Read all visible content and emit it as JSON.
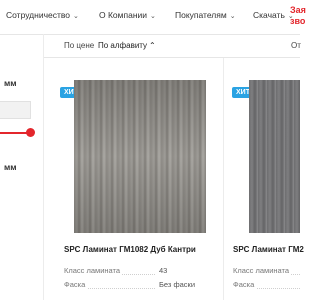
{
  "nav": {
    "items": [
      {
        "label": "Сотрудничество"
      },
      {
        "label": "О Компании"
      },
      {
        "label": "Покупателям"
      },
      {
        "label": "Скачать"
      }
    ],
    "cta_line1": "Зая",
    "cta_line2": "зво"
  },
  "sort": {
    "by_price": "По цене",
    "by_alpha": "По алфавиту",
    "right_cut": "От"
  },
  "sidebar": {
    "filter1_unit": "мм",
    "filter2_unit": "мм"
  },
  "products": [
    {
      "badge": "ХИТ",
      "title": "SPC Ламинат ГМ1082 Дуб Кантри",
      "props": [
        {
          "name": "Класс ламината",
          "value": "43"
        },
        {
          "name": "Фаска",
          "value": "Без фаски"
        }
      ]
    },
    {
      "badge": "ХИТ",
      "title": "SPC Ламинат ГМ2",
      "props": [
        {
          "name": "Класс ламината",
          "value": ""
        },
        {
          "name": "Фаска",
          "value": ""
        }
      ]
    }
  ],
  "colors": {
    "accent": "#e3262c",
    "badge": "#2aa3e3"
  }
}
